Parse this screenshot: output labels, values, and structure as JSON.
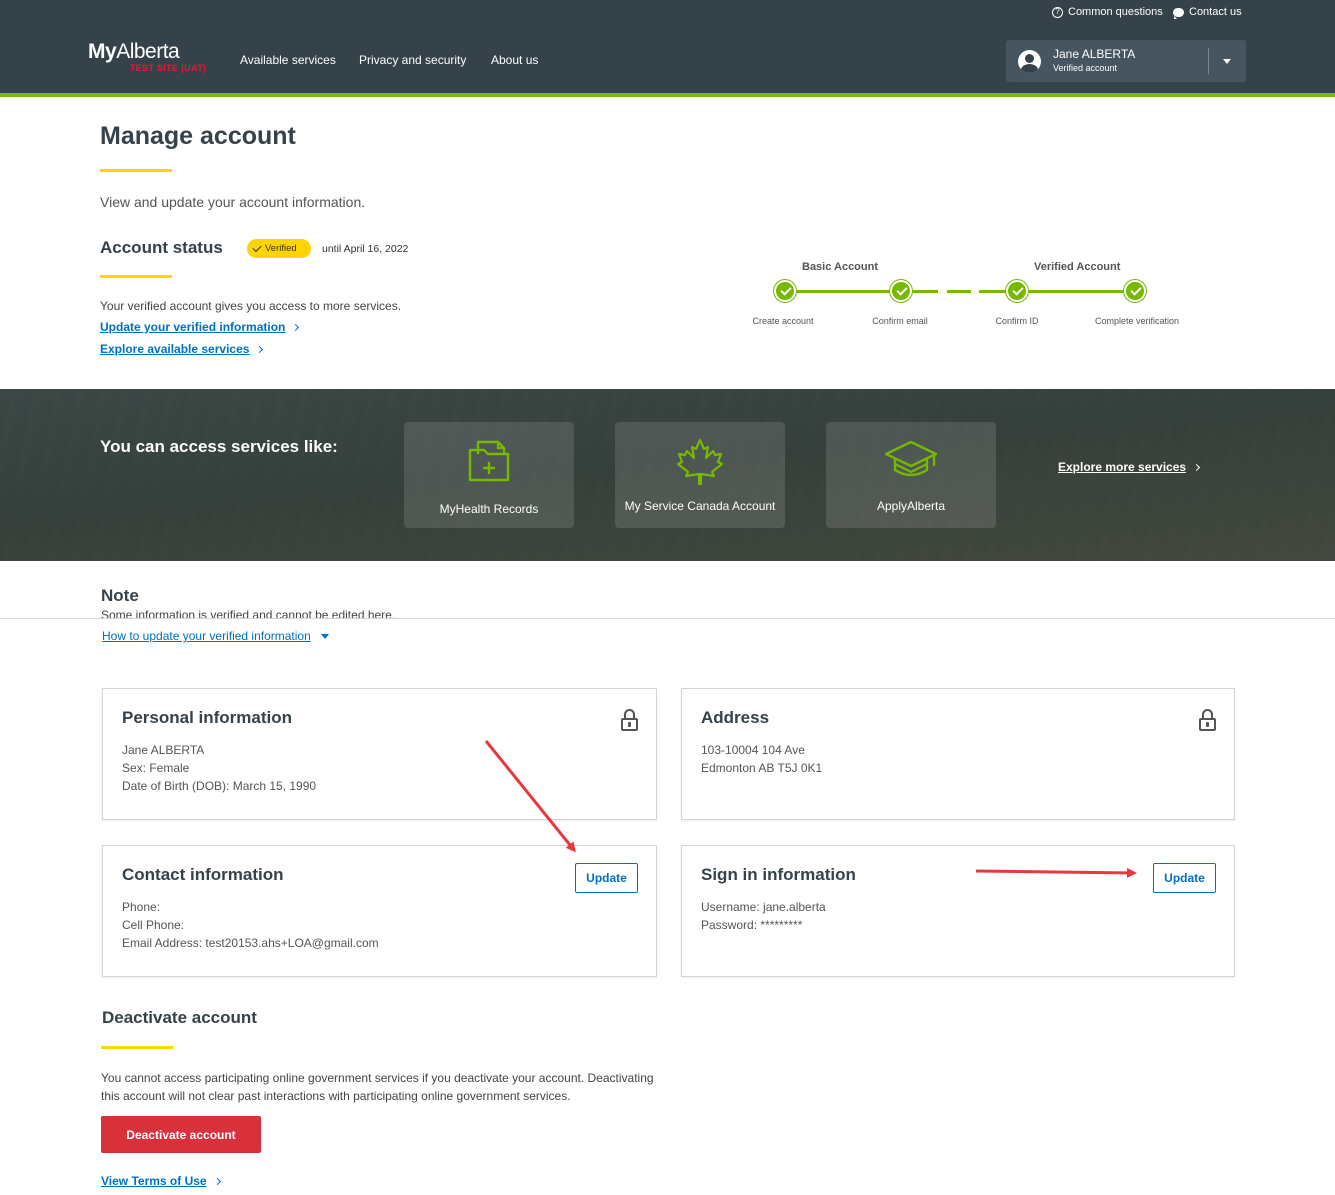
{
  "utility": {
    "common_questions": "Common questions",
    "contact_us": "Contact us"
  },
  "header": {
    "logo_my": "My",
    "logo_alberta": "Alberta",
    "logo_test": "TEST SITE (UAT)",
    "nav": [
      "Available services",
      "Privacy and security",
      "About us"
    ],
    "user_name": "Jane ALBERTA",
    "user_status": "Verified account"
  },
  "page": {
    "title": "Manage account",
    "subtitle": "View and update your account information."
  },
  "status": {
    "heading": "Account status",
    "badge": "Verified",
    "until": "until April 16, 2022",
    "description": "Your verified account gives you access to more services.",
    "link_update": "Update your verified information",
    "link_explore": "Explore available services"
  },
  "tracker": {
    "basic_title": "Basic Account",
    "verified_title": "Verified Account",
    "steps": [
      "Create account",
      "Confirm email",
      "Confirm ID",
      "Complete verification"
    ]
  },
  "services": {
    "heading": "You can access services like:",
    "cards": [
      "MyHealth Records",
      "My Service Canada Account",
      "ApplyAlberta"
    ],
    "explore_more": "Explore more services"
  },
  "note": {
    "heading": "Note",
    "text": "Some information is verified and cannot be edited here.",
    "link": "How to update your verified information"
  },
  "personal": {
    "title": "Personal information",
    "name": "Jane ALBERTA",
    "sex": "Sex: Female",
    "dob": "Date of Birth (DOB): March 15, 1990"
  },
  "address": {
    "title": "Address",
    "line1": "103-10004 104 Ave",
    "line2": "Edmonton AB T5J 0K1"
  },
  "contact": {
    "title": "Contact information",
    "update_label": "Update",
    "phone": "Phone:",
    "cell": "Cell Phone:",
    "email": "Email Address: test20153.ahs+LOA@gmail.com"
  },
  "signin": {
    "title": "Sign in information",
    "update_label": "Update",
    "username": "Username: jane.alberta",
    "password": "Password: *********"
  },
  "deactivate": {
    "heading": "Deactivate account",
    "text": "You cannot access participating online government services if you deactivate your account. Deactivating this account will not clear past interactions with participating online government services.",
    "button": "Deactivate account",
    "terms_link": "View Terms of Use"
  },
  "colors": {
    "header_bg": "#36424a",
    "accent_green": "#77b800",
    "accent_yellow": "#ffd700",
    "link_blue": "#0070c4",
    "danger_red": "#d9313c",
    "annotation_red": "#e8383b"
  }
}
